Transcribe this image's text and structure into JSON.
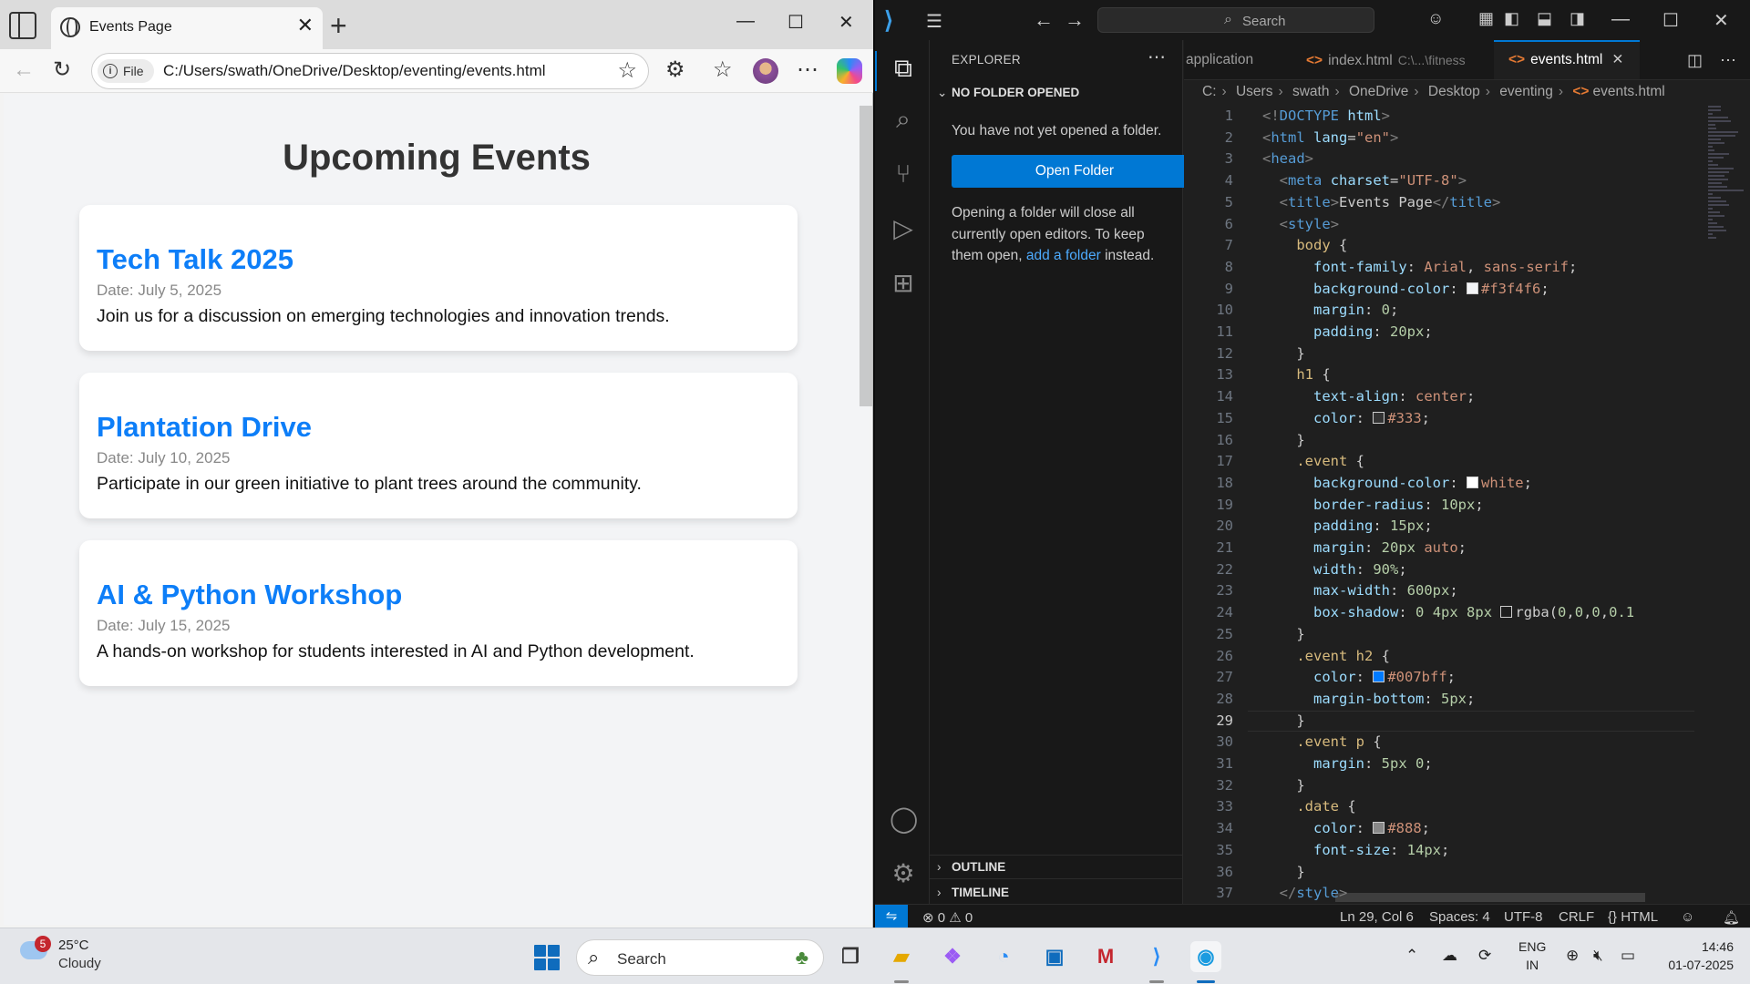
{
  "browser": {
    "tab_title": "Events Page",
    "file_label": "File",
    "url": "C:/Users/swath/OneDrive/Desktop/eventing/events.html",
    "page": {
      "heading": "Upcoming Events",
      "events": [
        {
          "title": "Tech Talk 2025",
          "date": "Date: July 5, 2025",
          "desc": "Join us for a discussion on emerging technologies and innovation trends."
        },
        {
          "title": "Plantation Drive",
          "date": "Date: July 10, 2025",
          "desc": "Participate in our green initiative to plant trees around the community."
        },
        {
          "title": "AI & Python Workshop",
          "date": "Date: July 15, 2025",
          "desc": "A hands-on workshop for students interested in AI and Python development."
        }
      ]
    }
  },
  "vscode": {
    "search_placeholder": "Search",
    "sidebar": {
      "title": "EXPLORER",
      "section_no_folder": "NO FOLDER OPENED",
      "no_folder_text": "You have not yet opened a folder.",
      "open_folder_button": "Open Folder",
      "info_text_1": "Opening a folder will close all currently open editors. To keep them open,",
      "info_link": "add a folder",
      "info_text_2": "instead.",
      "outline": "OUTLINE",
      "timeline": "TIMELINE"
    },
    "tabs": [
      {
        "label": "application",
        "desc": ""
      },
      {
        "label": "index.html",
        "desc": "C:\\...\\fitness"
      },
      {
        "label": "events.html",
        "desc": ""
      }
    ],
    "breadcrumb": [
      "C:",
      "Users",
      "swath",
      "OneDrive",
      "Desktop",
      "eventing",
      "events.html"
    ],
    "current_line": 29,
    "code_lines": [
      [
        [
          "br",
          "<!"
        ],
        [
          "tag",
          "DOCTYPE"
        ],
        [
          "txt",
          " "
        ],
        [
          "attr",
          "html"
        ],
        [
          "br",
          ">"
        ]
      ],
      [
        [
          "br",
          "<"
        ],
        [
          "tag",
          "html"
        ],
        [
          "txt",
          " "
        ],
        [
          "attr",
          "lang"
        ],
        [
          "txt",
          "="
        ],
        [
          "str",
          "\"en\""
        ],
        [
          "br",
          ">"
        ]
      ],
      [
        [
          "br",
          "<"
        ],
        [
          "tag",
          "head"
        ],
        [
          "br",
          ">"
        ]
      ],
      [
        [
          "txt",
          "  "
        ],
        [
          "br",
          "<"
        ],
        [
          "tag",
          "meta"
        ],
        [
          "txt",
          " "
        ],
        [
          "attr",
          "charset"
        ],
        [
          "txt",
          "="
        ],
        [
          "str",
          "\"UTF-8\""
        ],
        [
          "br",
          ">"
        ]
      ],
      [
        [
          "txt",
          "  "
        ],
        [
          "br",
          "<"
        ],
        [
          "tag",
          "title"
        ],
        [
          "br",
          ">"
        ],
        [
          "txt",
          "Events Page"
        ],
        [
          "br",
          "</"
        ],
        [
          "tag",
          "title"
        ],
        [
          "br",
          ">"
        ]
      ],
      [
        [
          "txt",
          "  "
        ],
        [
          "br",
          "<"
        ],
        [
          "tag",
          "style"
        ],
        [
          "br",
          ">"
        ]
      ],
      [
        [
          "txt",
          "    "
        ],
        [
          "sel",
          "body"
        ],
        [
          "txt",
          " {"
        ]
      ],
      [
        [
          "txt",
          "      "
        ],
        [
          "prop",
          "font-family"
        ],
        [
          "txt",
          ": "
        ],
        [
          "val",
          "Arial"
        ],
        [
          "txt",
          ", "
        ],
        [
          "val",
          "sans-serif"
        ],
        [
          "txt",
          ";"
        ]
      ],
      [
        [
          "txt",
          "      "
        ],
        [
          "prop",
          "background-color"
        ],
        [
          "txt",
          ": "
        ],
        [
          "sw",
          "#f3f4f6"
        ],
        [
          "val",
          "#f3f4f6"
        ],
        [
          "txt",
          ";"
        ]
      ],
      [
        [
          "txt",
          "      "
        ],
        [
          "prop",
          "margin"
        ],
        [
          "txt",
          ": "
        ],
        [
          "num",
          "0"
        ],
        [
          "txt",
          ";"
        ]
      ],
      [
        [
          "txt",
          "      "
        ],
        [
          "prop",
          "padding"
        ],
        [
          "txt",
          ": "
        ],
        [
          "num",
          "20px"
        ],
        [
          "txt",
          ";"
        ]
      ],
      [
        [
          "txt",
          "    }"
        ]
      ],
      [
        [
          "txt",
          "    "
        ],
        [
          "sel",
          "h1"
        ],
        [
          "txt",
          " {"
        ]
      ],
      [
        [
          "txt",
          "      "
        ],
        [
          "prop",
          "text-align"
        ],
        [
          "txt",
          ": "
        ],
        [
          "val",
          "center"
        ],
        [
          "txt",
          ";"
        ]
      ],
      [
        [
          "txt",
          "      "
        ],
        [
          "prop",
          "color"
        ],
        [
          "txt",
          ": "
        ],
        [
          "sw",
          "#333333"
        ],
        [
          "val",
          "#333"
        ],
        [
          "txt",
          ";"
        ]
      ],
      [
        [
          "txt",
          "    }"
        ]
      ],
      [
        [
          "txt",
          "    "
        ],
        [
          "sel",
          ".event"
        ],
        [
          "txt",
          " {"
        ]
      ],
      [
        [
          "txt",
          "      "
        ],
        [
          "prop",
          "background-color"
        ],
        [
          "txt",
          ": "
        ],
        [
          "sw",
          "#ffffff"
        ],
        [
          "val",
          "white"
        ],
        [
          "txt",
          ";"
        ]
      ],
      [
        [
          "txt",
          "      "
        ],
        [
          "prop",
          "border-radius"
        ],
        [
          "txt",
          ": "
        ],
        [
          "num",
          "10px"
        ],
        [
          "txt",
          ";"
        ]
      ],
      [
        [
          "txt",
          "      "
        ],
        [
          "prop",
          "padding"
        ],
        [
          "txt",
          ": "
        ],
        [
          "num",
          "15px"
        ],
        [
          "txt",
          ";"
        ]
      ],
      [
        [
          "txt",
          "      "
        ],
        [
          "prop",
          "margin"
        ],
        [
          "txt",
          ": "
        ],
        [
          "num",
          "20px"
        ],
        [
          "txt",
          " "
        ],
        [
          "val",
          "auto"
        ],
        [
          "txt",
          ";"
        ]
      ],
      [
        [
          "txt",
          "      "
        ],
        [
          "prop",
          "width"
        ],
        [
          "txt",
          ": "
        ],
        [
          "num",
          "90%"
        ],
        [
          "txt",
          ";"
        ]
      ],
      [
        [
          "txt",
          "      "
        ],
        [
          "prop",
          "max-width"
        ],
        [
          "txt",
          ": "
        ],
        [
          "num",
          "600px"
        ],
        [
          "txt",
          ";"
        ]
      ],
      [
        [
          "txt",
          "      "
        ],
        [
          "prop",
          "box-shadow"
        ],
        [
          "txt",
          ": "
        ],
        [
          "num",
          "0"
        ],
        [
          "txt",
          " "
        ],
        [
          "num",
          "4px"
        ],
        [
          "txt",
          " "
        ],
        [
          "num",
          "8px"
        ],
        [
          "txt",
          " "
        ],
        [
          "sw",
          "#1f1f1f"
        ],
        [
          "txt",
          "rgba("
        ],
        [
          "num",
          "0"
        ],
        [
          "txt",
          ","
        ],
        [
          "num",
          "0"
        ],
        [
          "txt",
          ","
        ],
        [
          "num",
          "0"
        ],
        [
          "txt",
          ","
        ],
        [
          "num",
          "0.1"
        ]
      ],
      [
        [
          "txt",
          "    }"
        ]
      ],
      [
        [
          "txt",
          "    "
        ],
        [
          "sel",
          ".event h2"
        ],
        [
          "txt",
          " {"
        ]
      ],
      [
        [
          "txt",
          "      "
        ],
        [
          "prop",
          "color"
        ],
        [
          "txt",
          ": "
        ],
        [
          "sw",
          "#007bff"
        ],
        [
          "val",
          "#007bff"
        ],
        [
          "txt",
          ";"
        ]
      ],
      [
        [
          "txt",
          "      "
        ],
        [
          "prop",
          "margin-bottom"
        ],
        [
          "txt",
          ": "
        ],
        [
          "num",
          "5px"
        ],
        [
          "txt",
          ";"
        ]
      ],
      [
        [
          "txt",
          "    }"
        ]
      ],
      [
        [
          "txt",
          "    "
        ],
        [
          "sel",
          ".event p"
        ],
        [
          "txt",
          " {"
        ]
      ],
      [
        [
          "txt",
          "      "
        ],
        [
          "prop",
          "margin"
        ],
        [
          "txt",
          ": "
        ],
        [
          "num",
          "5px"
        ],
        [
          "txt",
          " "
        ],
        [
          "num",
          "0"
        ],
        [
          "txt",
          ";"
        ]
      ],
      [
        [
          "txt",
          "    }"
        ]
      ],
      [
        [
          "txt",
          "    "
        ],
        [
          "sel",
          ".date"
        ],
        [
          "txt",
          " {"
        ]
      ],
      [
        [
          "txt",
          "      "
        ],
        [
          "prop",
          "color"
        ],
        [
          "txt",
          ": "
        ],
        [
          "sw",
          "#888888"
        ],
        [
          "val",
          "#888"
        ],
        [
          "txt",
          ";"
        ]
      ],
      [
        [
          "txt",
          "      "
        ],
        [
          "prop",
          "font-size"
        ],
        [
          "txt",
          ": "
        ],
        [
          "num",
          "14px"
        ],
        [
          "txt",
          ";"
        ]
      ],
      [
        [
          "txt",
          "    }"
        ]
      ],
      [
        [
          "txt",
          "  "
        ],
        [
          "br",
          "</"
        ],
        [
          "tag",
          "style"
        ],
        [
          "br",
          ">"
        ]
      ]
    ],
    "status": {
      "errors": "0",
      "warnings": "0",
      "position": "Ln 29, Col 6",
      "spaces": "Spaces: 4",
      "encoding": "UTF-8",
      "eol": "CRLF",
      "language": "HTML"
    }
  },
  "taskbar": {
    "weather_badge": "5",
    "temperature": "25°C",
    "condition": "Cloudy",
    "search_placeholder": "Search",
    "lang_1": "ENG",
    "lang_2": "IN",
    "time": "14:46",
    "date": "01-07-2025"
  }
}
